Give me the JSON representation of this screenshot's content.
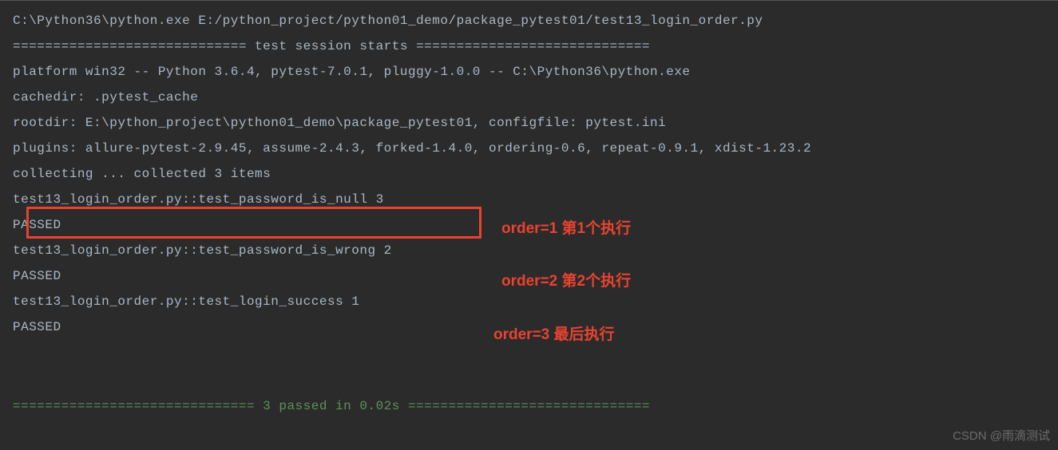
{
  "terminal": {
    "l1": "C:\\Python36\\python.exe E:/python_project/python01_demo/package_pytest01/test13_login_order.py",
    "l2": "============================= test session starts =============================",
    "l3": "platform win32 -- Python 3.6.4, pytest-7.0.1, pluggy-1.0.0 -- C:\\Python36\\python.exe",
    "l4": "cachedir: .pytest_cache",
    "l5": "rootdir: E:\\python_project\\python01_demo\\package_pytest01, configfile: pytest.ini",
    "l6": "plugins: allure-pytest-2.9.45, assume-2.4.3, forked-1.4.0, ordering-0.6, repeat-0.9.1, xdist-1.23.2",
    "l7": "collecting ... collected 3 items",
    "l8": "",
    "l9": "test13_login_order.py::test_password_is_null 3",
    "l10": "PASSED",
    "l11": "test13_login_order.py::test_password_is_wrong 2",
    "l12": "PASSED",
    "l13": "test13_login_order.py::test_login_success 1",
    "l14": "PASSED",
    "summary": "============================== 3 passed in 0.02s =============================="
  },
  "annotations": {
    "a1": "order=1 第1个执行",
    "a2": "order=2 第2个执行",
    "a3": "order=3 最后执行"
  },
  "watermark": "CSDN @雨滴测试"
}
